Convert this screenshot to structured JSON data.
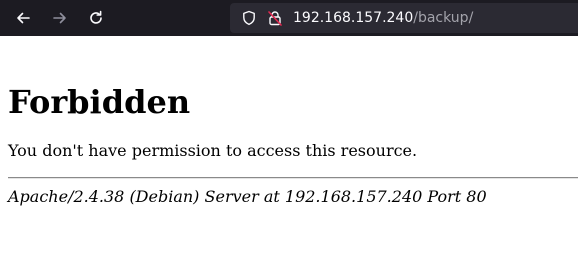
{
  "browser": {
    "url_host": "192.168.157.240",
    "url_path": "/backup/",
    "icons": {
      "back": "arrow-left-icon",
      "forward": "arrow-right-icon",
      "reload": "reload-icon",
      "tracking": "shield-icon",
      "security": "insecure-lock-icon"
    },
    "colors": {
      "toolbar_bg": "#1c1b22",
      "urlbar_bg": "#2b2a33",
      "insecure_lock": "#e22850"
    }
  },
  "page": {
    "title": "Forbidden",
    "message": "You don't have permission to access this resource.",
    "server_signature": "Apache/2.4.38 (Debian) Server at 192.168.157.240 Port 80"
  }
}
